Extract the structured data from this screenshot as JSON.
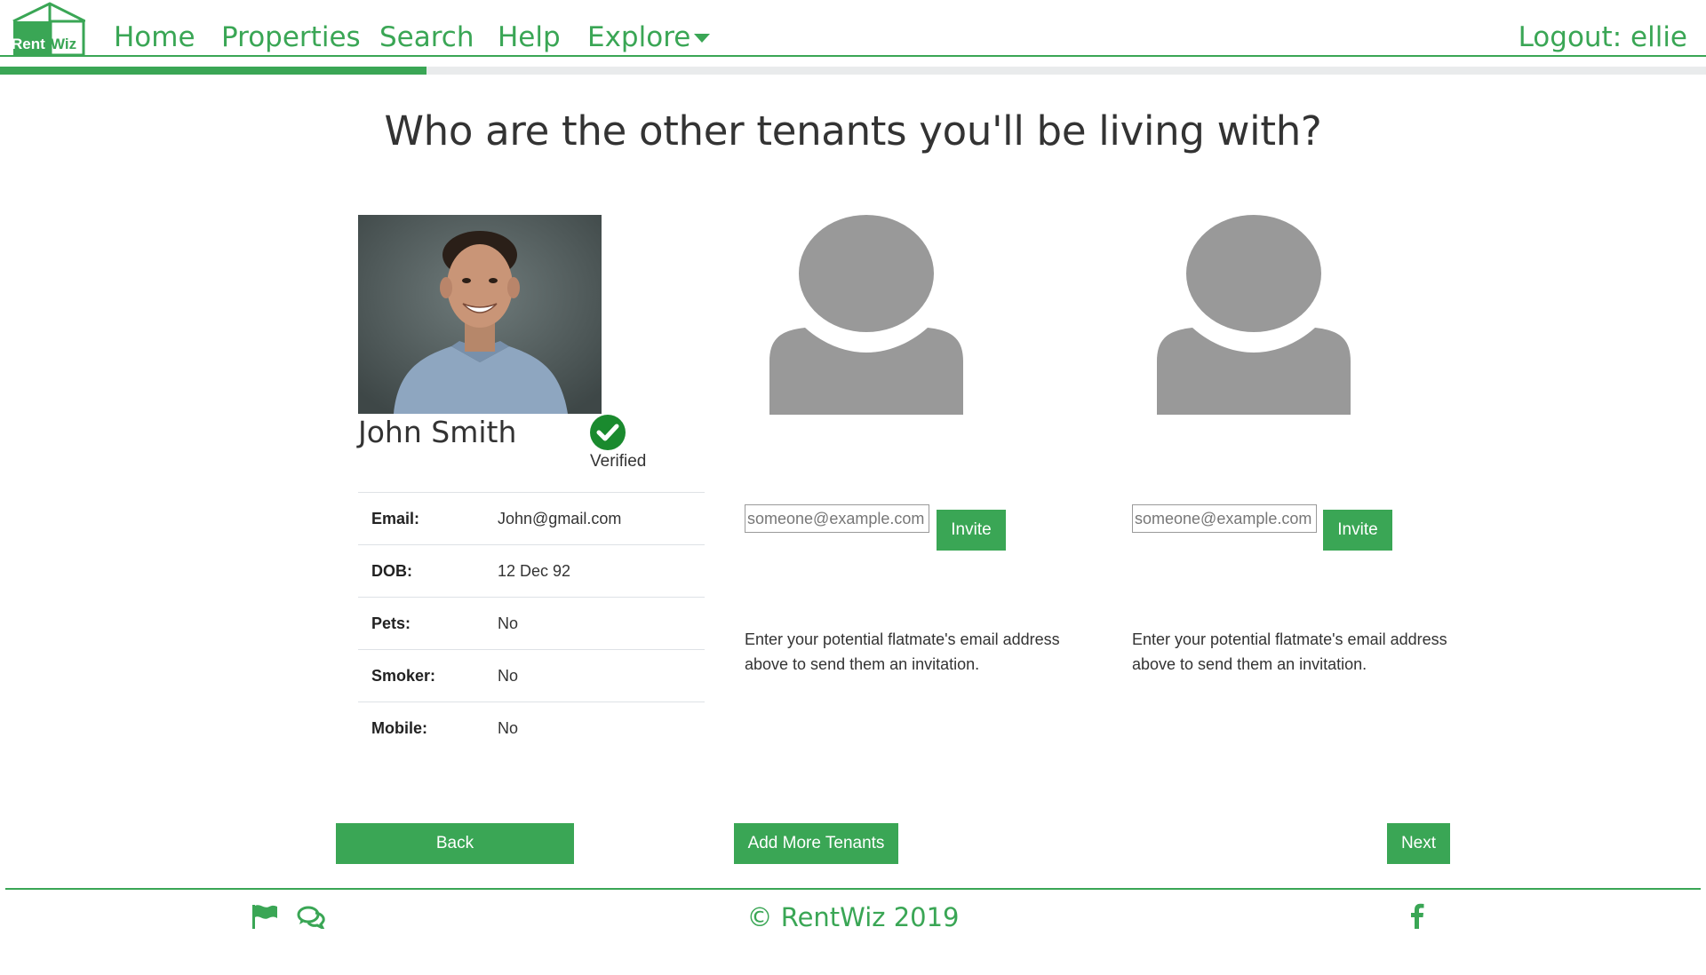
{
  "nav": {
    "logo_text": "RentWiz",
    "links": [
      "Home",
      "Properties",
      "Search",
      "Help",
      "Explore"
    ],
    "logout": "Logout: ellie"
  },
  "progress": {
    "fraction": 0.25
  },
  "heading": "Who are the other tenants you'll be living with?",
  "tenant": {
    "name": "John Smith",
    "verified_label": "Verified",
    "details": [
      {
        "key": "Email:",
        "value": "John@gmail.com"
      },
      {
        "key": "DOB:",
        "value": "12 Dec 92"
      },
      {
        "key": "Pets:",
        "value": "No"
      },
      {
        "key": "Smoker:",
        "value": "No"
      },
      {
        "key": "Mobile:",
        "value": "No"
      }
    ]
  },
  "invites": [
    {
      "placeholder": "someone@example.com",
      "button": "Invite",
      "help": "Enter your potential flatmate's email address above to send them an invitation."
    },
    {
      "placeholder": "someone@example.com",
      "button": "Invite",
      "help": "Enter your potential flatmate's email address above to send them an invitation."
    }
  ],
  "actions": {
    "back": "Back",
    "add_more": "Add More Tenants",
    "next": "Next"
  },
  "footer": {
    "copyright": "© RentWiz 2019",
    "icons": [
      "flag-icon",
      "comments-icon",
      "facebook-icon"
    ]
  },
  "colors": {
    "brand": "#3aa655",
    "placeholder_gray": "#999999",
    "verified": "#1a8a2e"
  }
}
